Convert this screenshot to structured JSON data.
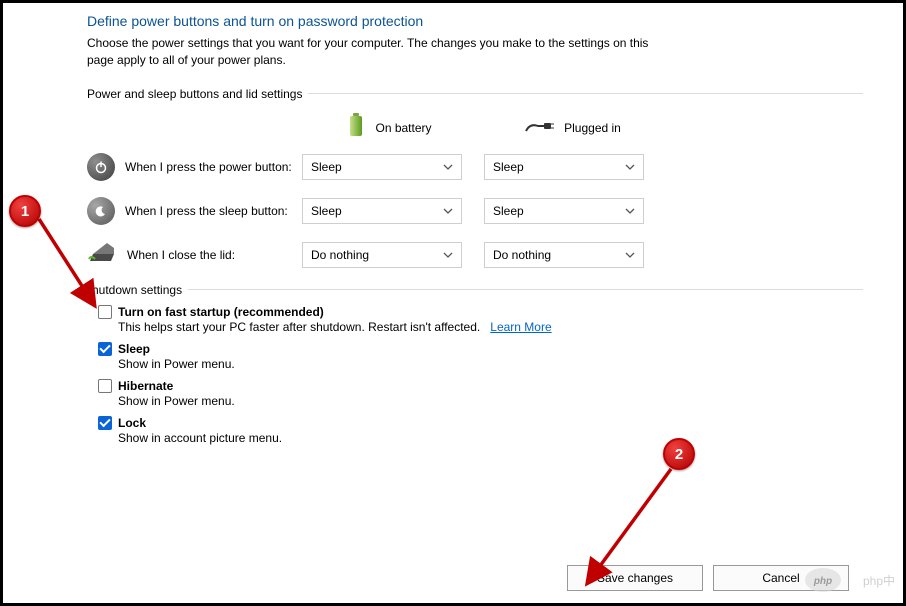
{
  "title": "Define power buttons and turn on password protection",
  "subtitle": "Choose the power settings that you want for your computer. The changes you make to the settings on this page apply to all of your power plans.",
  "section1": {
    "header": "Power and sleep buttons and lid settings",
    "col_battery": "On battery",
    "col_plugged": "Plugged in",
    "rows": {
      "power": {
        "label": "When I press the power button:",
        "battery": "Sleep",
        "plugged": "Sleep"
      },
      "sleep": {
        "label": "When I press the sleep button:",
        "battery": "Sleep",
        "plugged": "Sleep"
      },
      "lid": {
        "label": "When I close the lid:",
        "battery": "Do nothing",
        "plugged": "Do nothing"
      }
    }
  },
  "section2": {
    "header": "Shutdown settings",
    "fast_startup": {
      "title": "Turn on fast startup (recommended)",
      "checked": false,
      "desc": "This helps start your PC faster after shutdown. Restart isn't affected.",
      "link": "Learn More"
    },
    "sleep": {
      "title": "Sleep",
      "checked": true,
      "desc": "Show in Power menu."
    },
    "hibernate": {
      "title": "Hibernate",
      "checked": false,
      "desc": "Show in Power menu."
    },
    "lock": {
      "title": "Lock",
      "checked": true,
      "desc": "Show in account picture menu."
    }
  },
  "footer": {
    "save": "Save changes",
    "cancel": "Cancel"
  },
  "annotations": {
    "one": "1",
    "two": "2"
  },
  "watermark": "php中文网"
}
